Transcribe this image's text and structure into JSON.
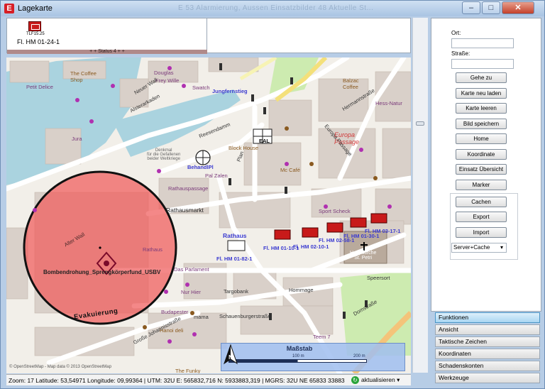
{
  "window": {
    "title": "Lagekarte",
    "app_icon": "E",
    "ghost_title": "E 53   Alarmierung, Aussen   Einsatzbilder   48   Aktuelle St..."
  },
  "unit_card": {
    "sub": "TLF15.25",
    "label": "Fl. HM 01-24-1",
    "status": "+ + Status 4 + +"
  },
  "panel": {
    "ort_label": "Ort:",
    "ort_value": "",
    "strasse_label": "Straße:",
    "strasse_value": "",
    "buttons": [
      "Gehe zu",
      "Karte neu laden",
      "Karte leeren",
      "Bild speichern",
      "Home",
      "Koordinate",
      "Einsatz Übersicht",
      "Marker"
    ],
    "group_buttons": [
      "Cachen",
      "Export",
      "Import"
    ],
    "select_value": "Server+Cache"
  },
  "accordion": [
    "Funktionen",
    "Ansicht",
    "Taktische Zeichen",
    "Koordinaten",
    "Schadenskonten",
    "Werkzeuge"
  ],
  "map": {
    "labels": {
      "coffee_shop": "The Coffee\nShop",
      "petit_delice": "Petit Delice",
      "neuer_wall": "Neuer Wall",
      "alsterarkaden": "Alsterarkaden",
      "jungfernstieg": "Jungfernstieg",
      "block_house": "Block House",
      "mc_cafe": "Mc Café",
      "rathausmarkt": "Rathausmarkt",
      "rathaus": "Rathaus",
      "rathaus_blue": "Rathaus",
      "europa_passage": "Europa\nPassage",
      "hermannstrasse": "Hermannstraße",
      "sport_scheck": "Sport Scheck",
      "speersort": "Speersort",
      "hauptkirche": "Hauptkirche\nSt. Petri",
      "domstrasse": "Domstraße",
      "hommage": "Hommage",
      "budapester": "Budapester",
      "hanoi_deli": "Hanoi deli",
      "schauenburger": "Schauenburgerstraße",
      "grosse_johannis": "Große Johannisstraße",
      "das_parlament": "Das Parlament",
      "nur_hier": "Nur Hier",
      "targobank": "Targobank",
      "mama": "mama",
      "the_funky": "The Funky",
      "teem7": "Teem 7",
      "balzac": "Balzac\nCoffee",
      "hess_natur": "Hess-Natur",
      "douglas": "Douglas",
      "swatch": "Swatch",
      "frey_wille": "Frey Wille",
      "jura": "Jura",
      "reesendamm": "Reesendamm",
      "rathauspassage": "Rathauspassage",
      "plan": "Plan",
      "alter_wall": "Alter Wall",
      "evakuierung": "Evakuierung",
      "bombendrohung": "Bombendrohung_Sprengkörperfund_USBV",
      "europa_passage2": "Europa Passage",
      "behandlpl": "BehandlPl",
      "pal_zalen": "Pal Zalen",
      "eal": "EAL",
      "gedenkmal": "Denkmal\nfür die Gefallenen\nbeider Weltkriege",
      "unit1": "Fl. HM 01-82-1",
      "unit2": "Fl. HM 01-10-1",
      "unit3": "Fl. HM 02-10-1",
      "unit4": "Fl. HM 02-58-1",
      "unit5": "Fl. HM 01-30-1",
      "unit6": "Fl. HM 03-17-1"
    },
    "scale": {
      "title": "Maßstab",
      "t0": "0",
      "t1": "100 m",
      "t2": "200 m"
    },
    "attribution": "© OpenStreetMap - Map data © 2013 OpenStreetMap",
    "colors": {
      "circle": "#f05a5a",
      "water": "#aad3df",
      "road": "#ffffff",
      "building": "#d9d0c9",
      "park": "#cdebb0"
    }
  },
  "footer": {
    "coords": "Zoom: 17  Latitude: 53,54971 Longitude: 09,99364 | UTM: 32U E: 565832,716 N: 5933883,319 | MGRS: 32U NE 65833 33883",
    "refresh": "aktualisieren",
    "refresh_arrow": "▾"
  }
}
